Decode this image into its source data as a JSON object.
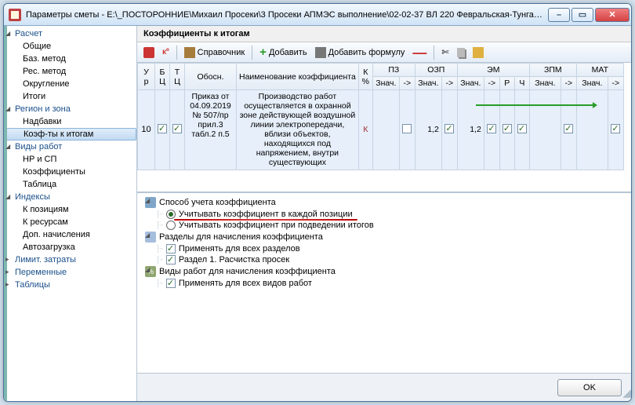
{
  "window": {
    "title": "Параметры сметы - E:\\_ПОСТОРОННИЕ\\Михаил Просеки\\3 Просеки АПМЭС выполнение\\02-02-37 ВЛ 220 Февральская-Тунгала(..."
  },
  "sidebar": {
    "items": [
      {
        "label": "Расчет",
        "level": 0,
        "expanded": true
      },
      {
        "label": "Общие",
        "level": 1
      },
      {
        "label": "Баз. метод",
        "level": 1
      },
      {
        "label": "Рес. метод",
        "level": 1
      },
      {
        "label": "Округление",
        "level": 1
      },
      {
        "label": "Итоги",
        "level": 1
      },
      {
        "label": "Регион и зона",
        "level": 0,
        "expanded": true
      },
      {
        "label": "Надбавки",
        "level": 1
      },
      {
        "label": "Коэф-ты к итогам",
        "level": 1,
        "selected": true
      },
      {
        "label": "Виды работ",
        "level": 0,
        "expanded": true
      },
      {
        "label": "НР и СП",
        "level": 1
      },
      {
        "label": "Коэффициенты",
        "level": 1
      },
      {
        "label": "Таблица",
        "level": 1
      },
      {
        "label": "Индексы",
        "level": 0,
        "expanded": true
      },
      {
        "label": "К позициям",
        "level": 1
      },
      {
        "label": "К ресурсам",
        "level": 1
      },
      {
        "label": "Доп. начисления",
        "level": 1
      },
      {
        "label": "Автозагрузка",
        "level": 1
      },
      {
        "label": "Лимит. затраты",
        "level": 0
      },
      {
        "label": "Переменные",
        "level": 0
      },
      {
        "label": "Таблицы",
        "level": 0
      }
    ]
  },
  "section": {
    "title": "Коэффициенты к итогам"
  },
  "toolbar": {
    "ref": "Справочник",
    "add": "Добавить",
    "add_formula": "Добавить формулу"
  },
  "table": {
    "head_row1": {
      "ur": "У\nр",
      "b": "Б\nЦ",
      "t": "Т\nЦ",
      "obosn": "Обосн.",
      "naim": "Наименование коэффициента",
      "k": "К\n%",
      "pz": "ПЗ",
      "ozp": "ОЗП",
      "em": "ЭМ",
      "zpm": "ЗПМ",
      "mat": "МАТ"
    },
    "head_row2": {
      "znach": "Знач.",
      "arrow": "->",
      "r": "Р",
      "ch": "Ч"
    },
    "row1": {
      "ur": "10",
      "b_checked": true,
      "t_checked": true,
      "obosn": "Приказ от 04.09.2019 № 507/пр прил.3 табл.2 п.5",
      "naim": "Производство работ осуществляется в охранной зоне действующей воздушной линии электропередачи, вблизи объектов, находящихся под напряжением, внутри существующих",
      "k": "К",
      "pz_znach": "",
      "pz_chk": false,
      "ozp_znach": "1,2",
      "ozp_chk": true,
      "em_znach": "1,2",
      "em_chk": true,
      "em_r": true,
      "em_ch": true,
      "zpm_znach": "",
      "zpm_chk": true,
      "mat_chk": true
    }
  },
  "options": {
    "g1": {
      "title": "Способ учета коэффициента",
      "r1": "Учитывать коэффициент в каждой позиции",
      "r2": "Учитывать коэффициент при подведении итогов"
    },
    "g2": {
      "title": "Разделы для начисления коэффициента",
      "c1": "Применять для всех разделов",
      "c2": "Раздел 1. Расчистка просек"
    },
    "g3": {
      "title": "Виды работ для начисления коэффициента",
      "c1": "Применять для всех видов работ"
    }
  },
  "footer": {
    "ok": "OK"
  }
}
